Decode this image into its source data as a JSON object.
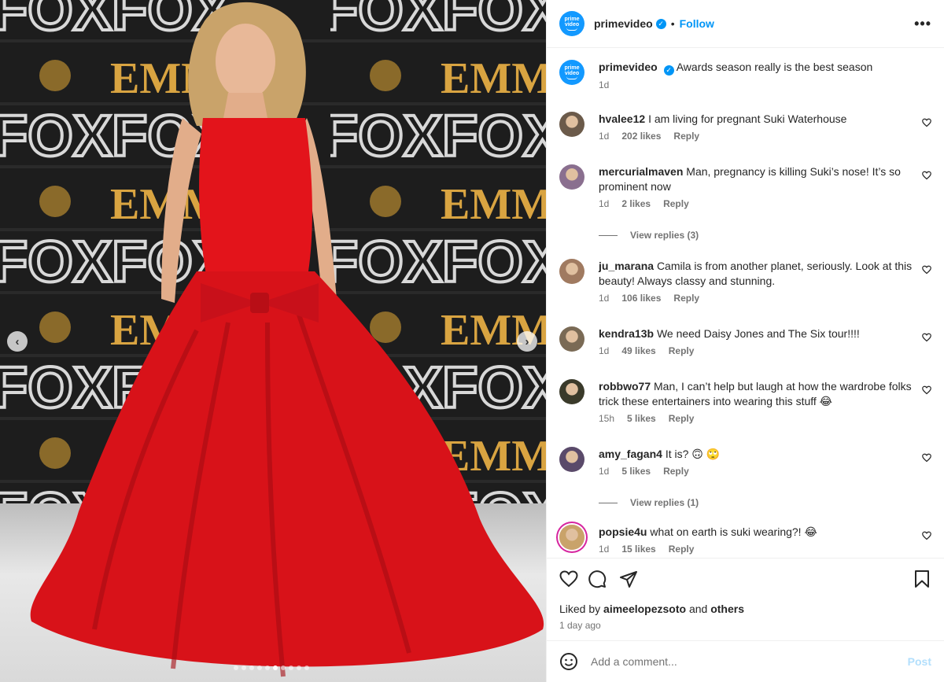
{
  "post": {
    "account": "primevideo",
    "logo_lines": [
      "prime",
      "video"
    ],
    "follow_label": "Follow",
    "separator": "•",
    "more_label": "•••",
    "carousel": {
      "slide_count": 10,
      "active_index": 5
    }
  },
  "caption": {
    "username": "primevideo",
    "text": "Awards season really is the best season",
    "time": "1d"
  },
  "comments": [
    {
      "username": "hvalee12",
      "text": "I am living for pregnant Suki Waterhouse",
      "time": "1d",
      "likes": "202 likes",
      "reply": "Reply"
    },
    {
      "username": "mercurialmaven",
      "text": "Man, pregnancy is killing Suki’s nose! It’s so prominent now",
      "time": "1d",
      "likes": "2 likes",
      "reply": "Reply",
      "view_replies": "View replies (3)"
    },
    {
      "username": "ju_marana",
      "text": "Camila is from another planet, seriously. Look at this beauty! Always classy and stunning.",
      "time": "1d",
      "likes": "106 likes",
      "reply": "Reply"
    },
    {
      "username": "kendra13b",
      "text": "We need Daisy Jones and The Six tour!!!!",
      "time": "1d",
      "likes": "49 likes",
      "reply": "Reply"
    },
    {
      "username": "robbwo77",
      "text": "Man, I can’t help but laugh at how the wardrobe folks trick these entertainers into wearing this stuff 😂",
      "time": "15h",
      "likes": "5 likes",
      "reply": "Reply"
    },
    {
      "username": "amy_fagan4",
      "text": "It is? 🙃 🙄",
      "time": "1d",
      "likes": "5 likes",
      "reply": "Reply",
      "view_replies": "View replies (1)"
    },
    {
      "username": "popsie4u",
      "text": "what on earth is suki wearing?! 😂",
      "time": "1d",
      "likes": "15 likes",
      "reply": "Reply"
    }
  ],
  "likes": {
    "prefix": "Liked by",
    "user": "aimeelopezsoto",
    "conj": "and",
    "others": "others",
    "ago": "1 day ago"
  },
  "comment_input": {
    "placeholder": "Add a comment...",
    "post_label": "Post"
  },
  "backdrop_words": [
    "FOX",
    "EMMYS"
  ],
  "colors": {
    "accent": "#0095f6",
    "brand": "#1399ff",
    "dress": "#e3141b",
    "emmys_gold": "#d9a441"
  }
}
